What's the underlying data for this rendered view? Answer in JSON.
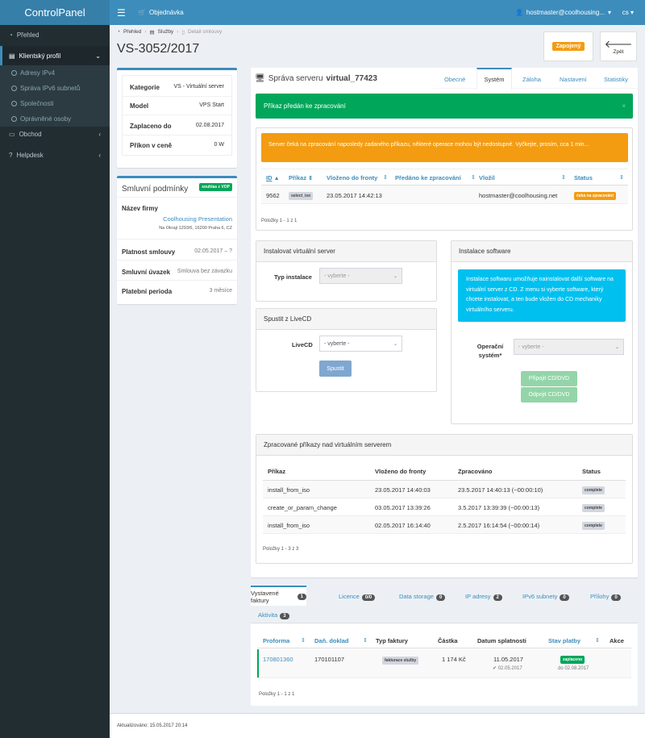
{
  "app": {
    "title": "ControlPanel"
  },
  "topbar": {
    "order_label": "Objednávka",
    "user": "hostmaster@coolhousing...",
    "lang": "cs"
  },
  "sidebar": {
    "items": [
      {
        "label": "Přehled"
      },
      {
        "label": "Klientský profil"
      },
      {
        "label": "Obchod"
      },
      {
        "label": "Helpdesk"
      }
    ],
    "subitems": [
      {
        "label": "Adresy IPv4"
      },
      {
        "label": "Správa IPv6 subnetů"
      },
      {
        "label": "Společnosti"
      },
      {
        "label": "Oprávněné osoby"
      }
    ]
  },
  "breadcrumb": {
    "items": [
      "Přehled",
      "Služby",
      "Detail smlouvy"
    ]
  },
  "page": {
    "title": "VS-3052/2017",
    "status_label": "Zapojený",
    "back_label": "Zpět"
  },
  "info": {
    "rows": [
      {
        "label": "Kategorie",
        "value": "VS - Virtuální server"
      },
      {
        "label": "Model",
        "value": "VPS Start"
      },
      {
        "label": "Zaplaceno do",
        "value": "02.08.2017"
      },
      {
        "label": "Příkon v ceně",
        "value": "0 W"
      }
    ]
  },
  "contract": {
    "title": "Smluvní podmínky",
    "badge": "souhlas z VOP",
    "company_label": "Název firmy",
    "company_name": "Coolhousing Presentation",
    "company_address": "Na Okraji 1293/6, 16200 Praha 6, CZ",
    "rows": [
      {
        "label": "Platnost smlouvy",
        "value": "02.05.2017 – ?"
      },
      {
        "label": "Smluvní úvazek",
        "value": "Smlouva bez závazku"
      },
      {
        "label": "Platební perioda",
        "value": "3 měsíce"
      }
    ]
  },
  "server": {
    "title_prefix": "Správa serveru",
    "title_name": "virtual_77423",
    "tabs": [
      "Obecné",
      "Systém",
      "Záloha",
      "Nastavení",
      "Statistiky"
    ],
    "active_tab": "Systém",
    "success_msg": "Příkaz předán ke zpracování",
    "warning_msg": "Server čeká na zpracování naposledy zadaného příkazu, některé operace mohou být nedostupné. Vyčkejte, prosím, cca 1 min...",
    "queue": {
      "headers": [
        "ID",
        "Příkaz",
        "Vloženo do fronty",
        "Předáno ke zpracování",
        "Vložil",
        "Status"
      ],
      "rows": [
        {
          "id": "9562",
          "cmd": "select_iso",
          "queued": "23.05.2017 14:42:13",
          "passed": "",
          "by": "hostmaster@coolhousing.net",
          "status": "čeká na zpracování"
        }
      ],
      "footer": "Položky 1 - 1 z 1"
    }
  },
  "install_vs": {
    "title": "Instalovat virtuální server",
    "type_label": "Typ instalace",
    "select": "- vyberte -"
  },
  "livecd": {
    "title": "Spustit z LiveCD",
    "label": "LiveCD",
    "select": "- vyberte -",
    "button": "Spustit"
  },
  "software": {
    "title": "Instalace software",
    "info": "Instalace softwaru umožňuje nainstalovat další software na virtuální server z CD. Z menu si vyberte software, který chcete instalovat, a ten bude vložen do CD mechaniky virtuálního serveru.",
    "os_label": "Operační systém*",
    "select": "- vyberte -",
    "attach": "Připojit CD/DVD",
    "detach": "Odpojit CD/DVD"
  },
  "processed": {
    "title": "Zpracované příkazy nad virtuálním serverem",
    "headers": [
      "Příkaz",
      "Vloženo do fronty",
      "Zpracováno",
      "Status"
    ],
    "rows": [
      {
        "cmd": "install_from_iso",
        "queued": "23.05.2017 14:40:03",
        "done": "23.5.2017 14:40:13 (~00:00:10)",
        "status": "complete"
      },
      {
        "cmd": "create_or_param_change",
        "queued": "03.05.2017 13:39:26",
        "done": "3.5.2017 13:39:39 (~00:00:13)",
        "status": "complete"
      },
      {
        "cmd": "install_from_iso",
        "queued": "02.05.2017 16:14:40",
        "done": "2.5.2017 16:14:54 (~00:00:14)",
        "status": "complete"
      }
    ],
    "footer": "Položky 1 - 3 z 3"
  },
  "bottom_tabs": [
    {
      "label": "Vystavené faktury",
      "count": "1"
    },
    {
      "label": "Licence",
      "count": "0/0"
    },
    {
      "label": "Data storage",
      "count": "0"
    },
    {
      "label": "IP adresy",
      "count": "2"
    },
    {
      "label": "IPv6 subnety",
      "count": "0"
    },
    {
      "label": "Přílohy",
      "count": "0"
    },
    {
      "label": "Aktivita",
      "count": "3"
    }
  ],
  "invoices": {
    "headers": [
      "Proforma",
      "Daň. doklad",
      "Typ faktury",
      "Částka",
      "Datum splatnosti",
      "Stav platby",
      "Akce"
    ],
    "rows": [
      {
        "proforma": "170801360",
        "tax": "170101107",
        "type": "fakturace služby",
        "amount": "1 174 Kč",
        "due": "11.05.2017",
        "paid_on": "02.05.2017",
        "state": "zaplaceno",
        "state_note": "do 02.08.2017"
      }
    ],
    "footer": "Položky 1 - 1 z 1"
  },
  "footer": {
    "updated": "Aktualizováno: 15.05.2017 20:14"
  }
}
